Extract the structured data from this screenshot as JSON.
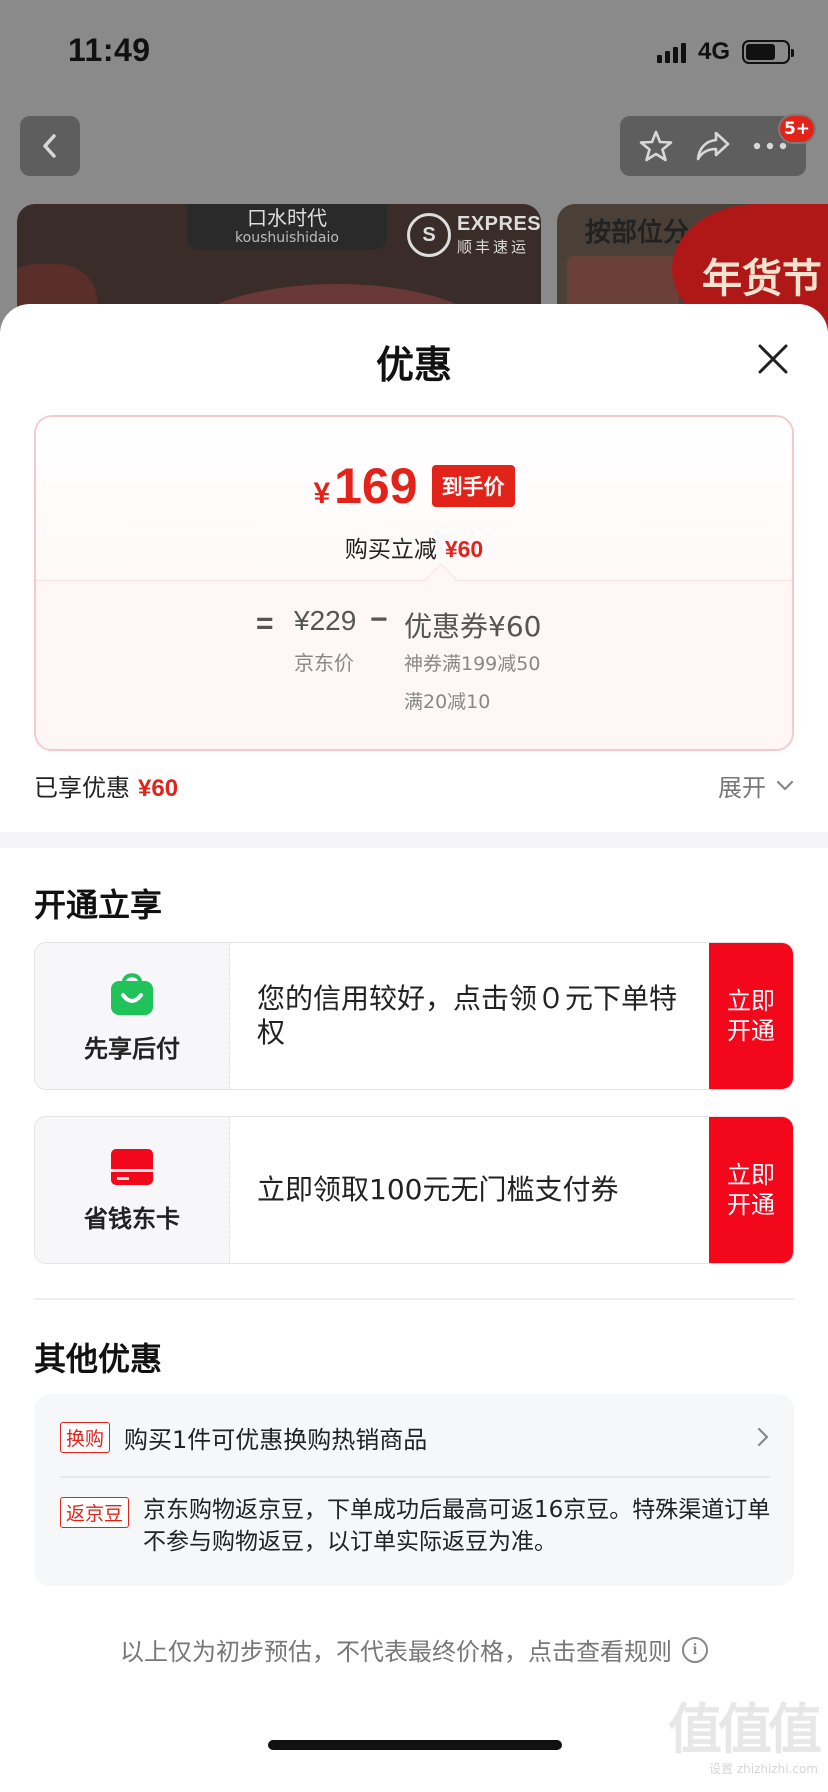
{
  "status_bar": {
    "time": "11:49",
    "network": "4G"
  },
  "header": {
    "cart_badge": "5+",
    "icons": [
      "back-icon",
      "star-icon",
      "share-icon",
      "more-icon"
    ]
  },
  "banner": {
    "brand_cn": "口水时代",
    "brand_pinyin": "koushuishidaio",
    "express_en": "EXPRESS",
    "express_cn": "顺丰速运",
    "banner2_title": "按部位分",
    "festival": "年货节"
  },
  "sheet": {
    "title": "优惠",
    "price_card": {
      "currency": "¥",
      "final_price": "169",
      "final_tag": "到手价",
      "reduce_label": "购买立减",
      "reduce_amount": "¥60",
      "equals": "=",
      "base_price": "¥229",
      "base_label": "京东价",
      "minus": "−",
      "coupon_label": "优惠券¥60",
      "coupon_detail_1": "神券满199减50",
      "coupon_detail_2": "满20减10"
    },
    "enjoyed": {
      "label": "已享优惠",
      "amount": "¥60"
    },
    "expand_label": "展开",
    "open_section": {
      "title": "开通立享",
      "offers": [
        {
          "name": "先享后付",
          "desc": "您的信用较好，点击领０元下单特权",
          "button": "立即开通",
          "icon": "shopping-bag-icon"
        },
        {
          "name": "省钱东卡",
          "desc": "立即领取100元无门槛支付券",
          "button": "立即开通",
          "icon": "card-icon"
        }
      ]
    },
    "other_section": {
      "title": "其他优惠",
      "items": [
        {
          "tag": "换购",
          "text": "购买1件可优惠换购热销商品"
        },
        {
          "tag": "返京豆",
          "text": "京东购物返京豆，下单成功后最高可返16京豆。特殊渠道订单不参与购物返豆，以订单实际返豆为准。"
        }
      ]
    },
    "footer_note": "以上仅为初步预估，不代表最终价格，点击查看规则"
  },
  "watermark": {
    "logo": "值值值",
    "url": "zhizhizhi.com",
    "left_text": "设置"
  },
  "colors": {
    "accent_red": "#e2231a",
    "button_red": "#f2071b",
    "green": "#1fc35a"
  }
}
